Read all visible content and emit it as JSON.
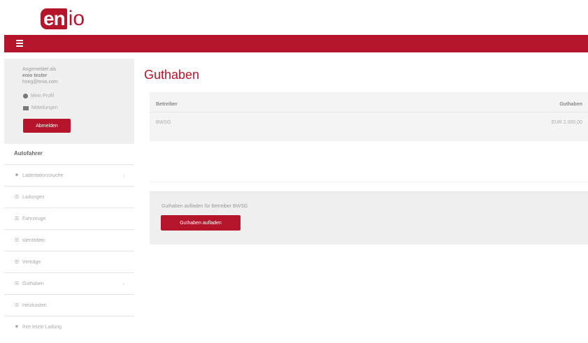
{
  "brand": {
    "logo_part1": "en",
    "logo_part2": "io",
    "accent": "#b5152b"
  },
  "user": {
    "logged_in_as": "Angemeldet als",
    "name": "enio tester",
    "email": "hseg@enio.com",
    "my_profile": "Mein Profil",
    "messages": "Mitteilungen",
    "logout": "Abmelden"
  },
  "sidebar": {
    "section_title": "Autofahrer",
    "items": [
      {
        "label": "Ladestationssuche",
        "icon": "map-pin-icon",
        "chevron": true
      },
      {
        "label": "Ladungen",
        "icon": "list-icon",
        "chevron": false
      },
      {
        "label": "Fahrzeuge",
        "icon": "list-icon",
        "chevron": false
      },
      {
        "label": "Identitäten",
        "icon": "list-icon",
        "chevron": false
      },
      {
        "label": "Verträge",
        "icon": "list-icon",
        "chevron": false
      },
      {
        "label": "Guthaben",
        "icon": "list-icon",
        "chevron": true
      },
      {
        "label": "Heizkosten",
        "icon": "list-icon",
        "chevron": false
      },
      {
        "label": "Ihre letzte Ladung",
        "icon": "map-pin-icon",
        "chevron": false
      }
    ]
  },
  "page": {
    "title": "Guthaben"
  },
  "table": {
    "columns": [
      "Betreiber",
      "Guthaben"
    ],
    "rows": [
      {
        "operator": "BWSG",
        "balance": "EUR 2.000,00"
      }
    ]
  },
  "topup": {
    "text": "Guthaben aufladen für Betreiber BWSG",
    "button": "Guthaben aufladen"
  }
}
